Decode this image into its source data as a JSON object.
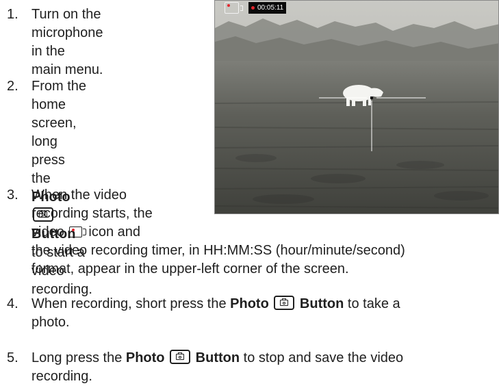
{
  "steps": [
    {
      "number": "1.",
      "lines": [
        "Turn on the",
        "microphone in the",
        "main menu."
      ]
    },
    {
      "number": "2.",
      "line1": "From the home",
      "line2": "screen, long press",
      "line3_pre": "the ",
      "photo": "Photo",
      "button": "Button",
      "line4": "to start a video",
      "line5": "recording."
    },
    {
      "number": "3.",
      "line1": "When the video",
      "line2": "recording starts, the",
      "line3_pre": "video ",
      "line3_post": "icon and",
      "line4": "the video recording timer, in HH:MM:SS (hour/minute/second)",
      "line5": "format, appear in the upper-left corner of the screen."
    },
    {
      "number": "4.",
      "line1_pre": "When recording, short press the ",
      "photo": "Photo",
      "button": "Button",
      "line1_post": " to take a",
      "line2": "photo."
    },
    {
      "number": "5.",
      "line1_pre": "Long press the ",
      "photo": "Photo",
      "button": "Button",
      "line1_post": " to stop and save the video",
      "line2": "recording."
    }
  ],
  "overlay": {
    "timer": "00:05:11",
    "record_icon": "video-camera-icon",
    "record_dot_color": "#e3262d"
  },
  "icons": {
    "photo_button": "camera-button-icon",
    "video": "video-camera-icon"
  }
}
